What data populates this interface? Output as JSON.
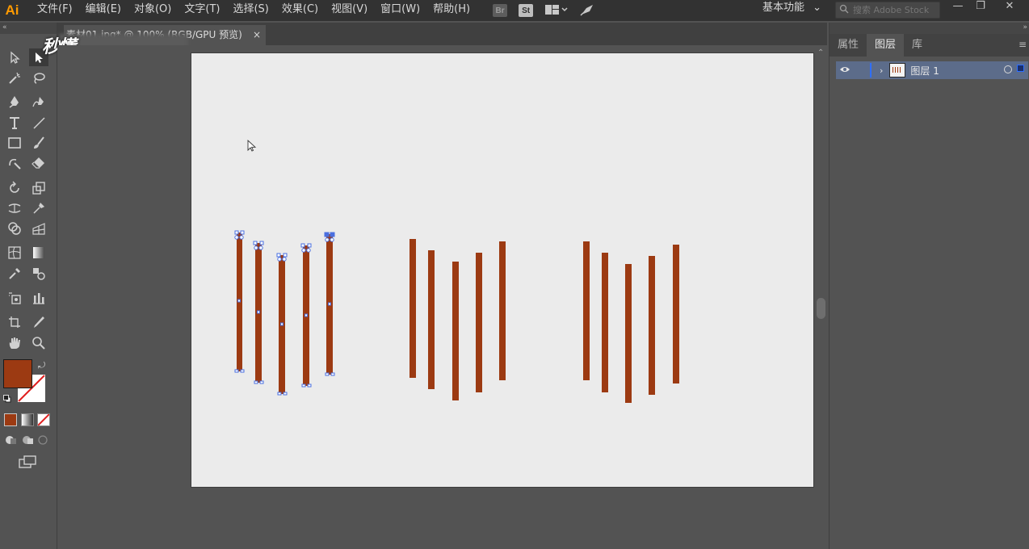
{
  "app": {
    "logo": "Ai",
    "logo_color": "#ff9a00"
  },
  "menu": [
    "文件(F)",
    "编辑(E)",
    "对象(O)",
    "文字(T)",
    "选择(S)",
    "效果(C)",
    "视图(V)",
    "窗口(W)",
    "帮助(H)"
  ],
  "menu_icons": {
    "bridge": "Br",
    "stock": "St"
  },
  "workspace": "基本功能",
  "search": {
    "placeholder": "搜索 Adobe Stock"
  },
  "window_buttons": {
    "minimize": "—",
    "restore": "❐",
    "close": "✕"
  },
  "document_tab": {
    "title": "素材01.jpg* @ 100% (RGB/GPU 预览)",
    "close": "×"
  },
  "watermark_text": "秒懂",
  "tools": [
    "selection-tool",
    "direct-selection-tool",
    "magic-wand-tool",
    "lasso-tool",
    "pen-tool",
    "curvature-tool",
    "type-tool",
    "line-segment-tool",
    "rectangle-tool",
    "paintbrush-tool",
    "shaper-tool",
    "eraser-tool",
    "rotate-tool",
    "scale-tool",
    "width-tool",
    "puppet-warp-tool",
    "shape-builder-tool",
    "perspective-grid-tool",
    "mesh-tool",
    "gradient-tool",
    "eyedropper-tool",
    "blend-tool",
    "symbol-sprayer-tool",
    "column-graph-tool",
    "artboard-tool",
    "slice-tool",
    "hand-tool",
    "zoom-tool"
  ],
  "colors": {
    "fill": "#9c3a12",
    "stroke": "none",
    "bar_color": "#9c3a12",
    "anchor_color": "#4a6fe0",
    "artboard_bg": "#ebebeb",
    "ui_dark": "#323232",
    "ui_mid": "#535353"
  },
  "panel": {
    "tabs": [
      "属性",
      "图层",
      "库"
    ],
    "active_tab": "图层",
    "layers": [
      {
        "name": "图层 1",
        "visible": true,
        "selected": true
      }
    ]
  }
}
